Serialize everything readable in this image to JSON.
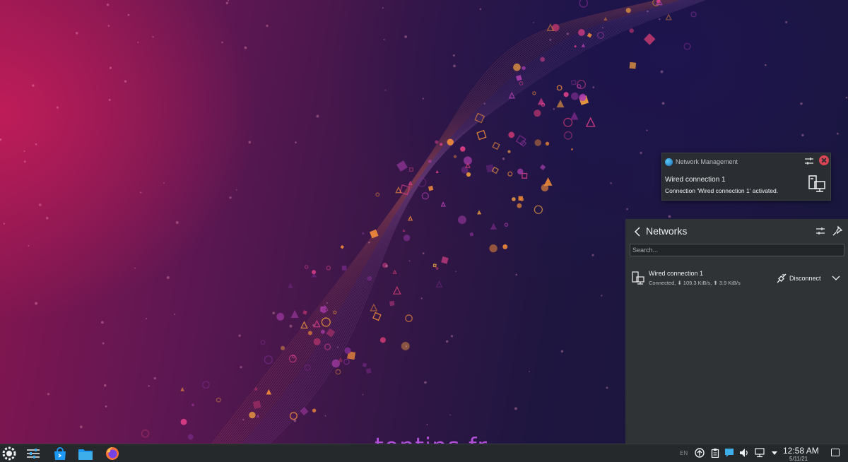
{
  "wallpaper": {
    "watermark": "toptips.fr"
  },
  "notification": {
    "app_name": "Network Management",
    "title": "Wired connection 1",
    "body": "Connection 'Wired connection 1' activated.",
    "icons": {
      "app": "globe-icon",
      "configure": "configure-icon",
      "close": "close-icon",
      "network": "wired-network-icon"
    }
  },
  "networks": {
    "title": "Networks",
    "search_placeholder": "Search...",
    "connections": [
      {
        "name": "Wired connection 1",
        "status": "Connected, ⬇ 109.3 KiB/s, ⬆ 3.9 KiB/s",
        "action": "Disconnect"
      }
    ]
  },
  "taskbar": {
    "keyboard_layout": "EN",
    "clock_time": "12:58 AM",
    "clock_date": "5/11/21",
    "items": [
      "application-launcher",
      "system-settings",
      "discover",
      "dolphin",
      "firefox"
    ],
    "tray": [
      "updates-icon",
      "clipboard-icon",
      "notifications-icon",
      "volume-icon",
      "network-icon",
      "expand-tray-icon"
    ]
  },
  "colors": {
    "panel_bg": "#2f3336",
    "taskbar_bg": "#25292c",
    "close_red": "#da4453",
    "accent_blue": "#3daee9",
    "watermark": "#b04fd8"
  }
}
